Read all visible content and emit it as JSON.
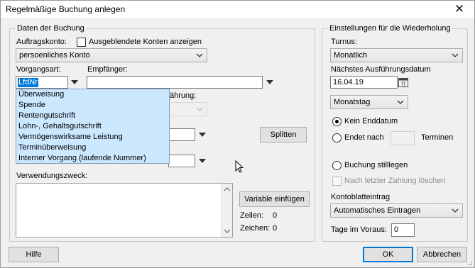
{
  "window": {
    "title": "Regelmäßige Buchung anlegen"
  },
  "booking_group": {
    "label": "Daten der Buchung",
    "account_label": "Auftragskonto:",
    "hidden_accounts_label": "Ausgeblendete Konten anzeigen",
    "account_value": "persoenliches Konto",
    "transaction_type_label": "Vorgangsart:",
    "transaction_type_value": "LfdNr",
    "recipient_label": "Empfänger:",
    "recipient_value": "",
    "partial_label": "ährung:",
    "split_button": "Splitten",
    "purpose_label": "Verwendungszweck:",
    "insert_variable_button": "Variable einfügen",
    "lines_label": "Zeilen:",
    "lines_value": "0",
    "chars_label": "Zeichen:",
    "chars_value": "0"
  },
  "transaction_type_options": [
    "Überweisung",
    "Spende",
    "Rentengutschrift",
    "Lohn-, Gehaltsgutschrift",
    "Vermögenswirksame Leistung",
    "Terminüberweisung",
    "Interner Vorgang (laufende Nummer)"
  ],
  "repeat_group": {
    "label": "Einstellungen für die Wiederholung",
    "interval_label": "Turnus:",
    "interval_value": "Monatlich",
    "next_date_label": "Nächstes Ausführungsdatum",
    "next_date_value": "16.04.19",
    "day_mode_value": "Monatstag",
    "no_end_label": "Kein Enddatum",
    "ends_after_label": "Endet nach",
    "ends_after_value": "",
    "terms_label": "Terminen",
    "pause_label": "Buchung stilllegen",
    "after_last_payment_label": "Nach letzter Zahlung löschen",
    "ledger_label": "Kontoblatteintrag",
    "ledger_value": "Automatisches Eintragen",
    "days_ahead_label": "Tage im Voraus:",
    "days_ahead_value": "0"
  },
  "footer": {
    "help_button": "Hilfe",
    "ok_button": "OK",
    "cancel_button": "Abbrechen"
  }
}
